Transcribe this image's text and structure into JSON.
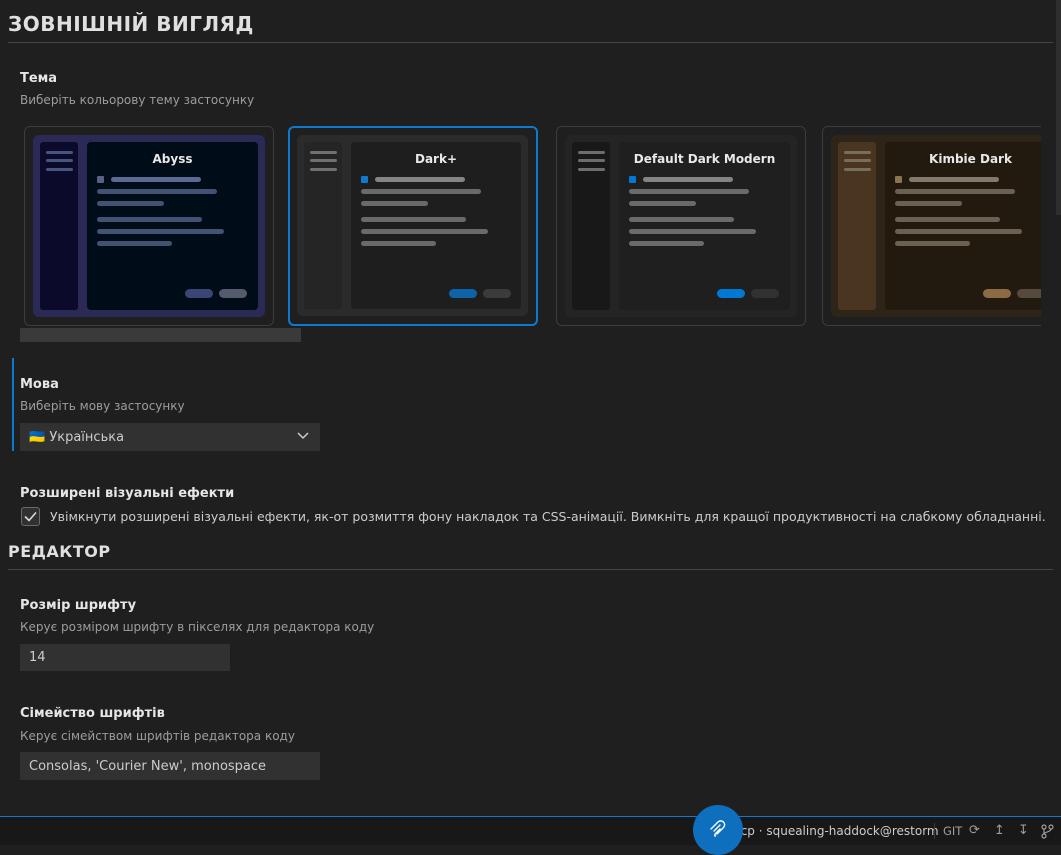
{
  "appearance": {
    "title": "ЗОВНІШНІЙ ВИГЛЯД",
    "theme": {
      "label": "Тема",
      "description": "Виберіть кольорову тему застосунку",
      "cards": [
        {
          "name": "Abyss",
          "selected": false,
          "colors": {
            "outer": "#2b2a56",
            "side": "#0b0a2b",
            "main": "#000c18",
            "line": "#606f9a",
            "dot": "#5a5f85",
            "btn1": "#3b4676",
            "btn2": "#555a6c"
          }
        },
        {
          "name": "Dark+",
          "selected": true,
          "colors": {
            "outer": "#2b2b2b",
            "side": "#252526",
            "main": "#1e1e1e",
            "line": "#8a8a8a",
            "dot": "#0e7acf",
            "btn1": "#0e63a8",
            "btn2": "#3b3b3b"
          }
        },
        {
          "name": "Default Dark Modern",
          "selected": false,
          "colors": {
            "outer": "#242424",
            "side": "#181818",
            "main": "#1f1f1f",
            "line": "#8a8a8a",
            "dot": "#0078d4",
            "btn1": "#0078d4",
            "btn2": "#313131"
          }
        },
        {
          "name": "Kimbie Dark",
          "selected": false,
          "colors": {
            "outer": "#2e2418",
            "side": "#4a3620",
            "main": "#221a0f",
            "line": "#8a8070",
            "dot": "#8b7253",
            "btn1": "#8b6a45",
            "btn2": "#554a3d"
          }
        }
      ]
    },
    "language": {
      "label": "Мова",
      "description": "Виберіть мову застосунку",
      "selected": "🇺🇦 Українська"
    },
    "visual_effects": {
      "label": "Розширені візуальні ефекти",
      "checkbox_text": "Увімкнути розширені візуальні ефекти, як-от розмиття фону накладок та CSS-анімації. Вимкніть для кращої продуктивності на слабкому обладнанні.",
      "checked": true
    }
  },
  "editor": {
    "title": "РЕДАКТОР",
    "font_size": {
      "label": "Розмір шрифту",
      "description": "Керує розміром шрифту в пікселях для редактора коду",
      "value": "14"
    },
    "font_family": {
      "label": "Сімейство шрифтів",
      "description": "Керує сімейством шрифтів редактора коду",
      "value": "Consolas, 'Courier New', monospace"
    }
  },
  "statusbar": {
    "connection": "mcp · squealing-haddock@restorm",
    "git": "GIT"
  },
  "colors": {
    "accent": "#0e7acf",
    "background": "#1f1f1f"
  }
}
